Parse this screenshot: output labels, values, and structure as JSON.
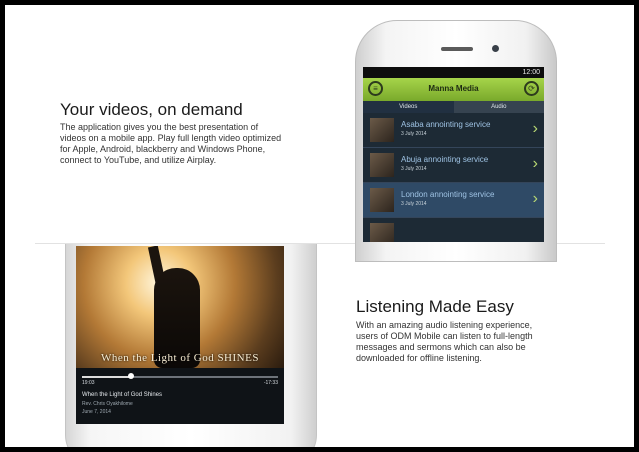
{
  "section1": {
    "heading": "Your videos, on demand",
    "body": "The application gives you the best presentation of videos on a mobile app. Play full length video optimized for Apple, Android, blackberry and Windows Phone, connect to YouTube, and utilize Airplay."
  },
  "section2": {
    "heading": "Listening Made Easy",
    "body": "With an amazing audio listening experience, users of ODM Mobile can listen to full-length messages and sermons which can also be downloaded for offline listening."
  },
  "phone_top": {
    "status_time": "12:00",
    "app_title": "Manna Media",
    "tabs": [
      "Videos",
      "Audio"
    ],
    "rows": [
      {
        "title": "Asaba annointing service",
        "date": "3 July 2014"
      },
      {
        "title": "Abuja annointing service",
        "date": "3 July 2014"
      },
      {
        "title": "London annointing service",
        "date": "3 July 2014"
      }
    ]
  },
  "phone_bottom": {
    "art_title": "When the Light of God SHINES",
    "time_elapsed": "19:03",
    "time_remaining": "-17:33",
    "progress": 0.25,
    "track_title": "When the Light of God Shines",
    "track_subtitle": "Rev. Chris Oyakhilome",
    "track_date": "June 7, 2014"
  },
  "colors": {
    "accent_green": "#8dc63f",
    "screen_bg": "#1d2a35"
  }
}
